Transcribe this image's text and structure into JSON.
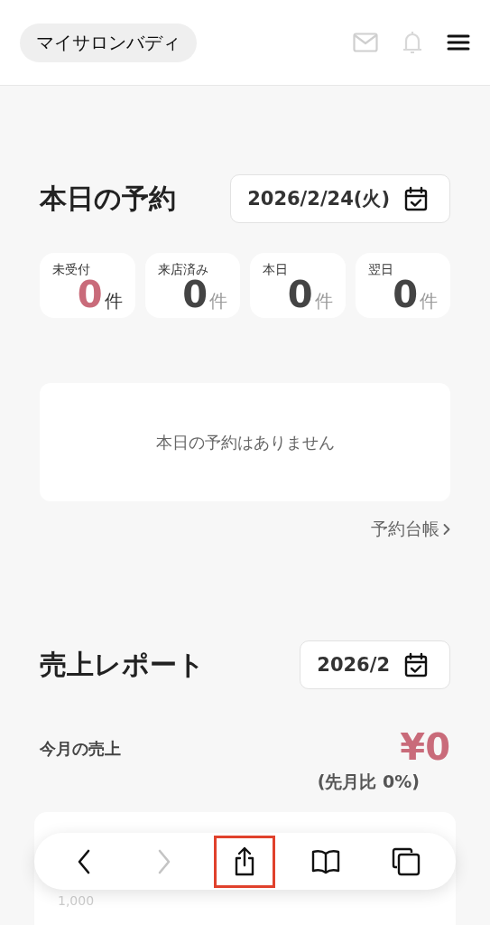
{
  "header": {
    "app_name": "マイサロンバディ"
  },
  "reservations": {
    "title": "本日の予約",
    "date": "2026/2/24(火)",
    "stats": [
      {
        "label": "未受付",
        "count": "0",
        "unit": "件",
        "kind": "alert"
      },
      {
        "label": "来店済み",
        "count": "0",
        "unit": "件",
        "kind": "normal"
      },
      {
        "label": "本日",
        "count": "0",
        "unit": "件",
        "kind": "normal"
      },
      {
        "label": "翌日",
        "count": "0",
        "unit": "件",
        "kind": "normal"
      }
    ],
    "empty_message": "本日の予約はありません",
    "link": "予約台帳"
  },
  "sales": {
    "title": "売上レポート",
    "month": "2026/2",
    "label": "今月の売上",
    "amount": "¥0",
    "comparison": "(先月比 0%)",
    "axis_label": "1,000"
  },
  "toolbar": [
    {
      "kind": "back",
      "disabled": false,
      "highlighted": false
    },
    {
      "kind": "forward",
      "disabled": true,
      "highlighted": false
    },
    {
      "kind": "share",
      "disabled": false,
      "highlighted": true
    },
    {
      "kind": "bookmarks",
      "disabled": false,
      "highlighted": false
    },
    {
      "kind": "tabs",
      "disabled": false,
      "highlighted": false
    }
  ]
}
